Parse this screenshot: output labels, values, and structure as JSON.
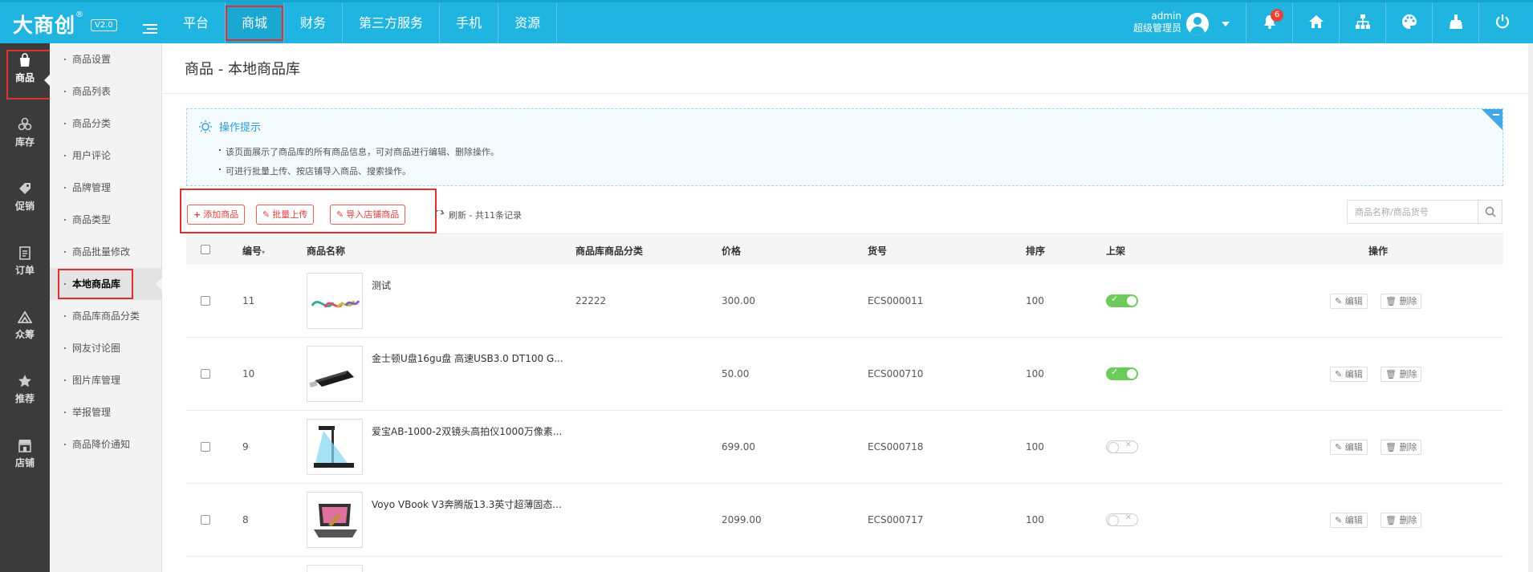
{
  "header": {
    "logo": "大商创",
    "logo_mark": "®",
    "version": "V2.0",
    "nav": [
      "平台",
      "商城",
      "财务",
      "第三方服务",
      "手机",
      "资源"
    ],
    "active_nav": "商城",
    "user_name": "admin",
    "user_role": "超级管理员",
    "notification_count": "6",
    "tools": [
      "bell-icon",
      "home-icon",
      "sitemap-icon",
      "palette-icon",
      "clean-icon",
      "power-icon"
    ]
  },
  "iconbar": [
    {
      "label": "商品",
      "icon": "bag-icon",
      "active": true
    },
    {
      "label": "库存",
      "icon": "stock-icon"
    },
    {
      "label": "促销",
      "icon": "tag-icon"
    },
    {
      "label": "订单",
      "icon": "order-icon"
    },
    {
      "label": "众筹",
      "icon": "crowdfund-icon"
    },
    {
      "label": "推荐",
      "icon": "star-icon"
    },
    {
      "label": "店铺",
      "icon": "store-icon"
    }
  ],
  "subnav": [
    "商品设置",
    "商品列表",
    "商品分类",
    "用户评论",
    "品牌管理",
    "商品类型",
    "商品批量修改",
    "本地商品库",
    "商品库商品分类",
    "网友讨论圈",
    "图片库管理",
    "举报管理",
    "商品降价通知"
  ],
  "active_subnav": "本地商品库",
  "page": {
    "title": "商品 - 本地商品库",
    "tips_title": "操作提示",
    "tips": [
      "该页面展示了商品库的所有商品信息，可对商品进行编辑、删除操作。",
      "可进行批量上传、按店铺导入商品、搜索操作。"
    ],
    "buttons": {
      "add": "添加商品",
      "batch_upload": "批量上传",
      "import": "导入店铺商品"
    },
    "refresh_text": "刷新 - 共11条记录",
    "search_placeholder": "商品名称/商品货号"
  },
  "table": {
    "headers": {
      "id": "编号",
      "name": "商品名称",
      "category": "商品库商品分类",
      "price": "价格",
      "sn": "货号",
      "sort": "排序",
      "on_sale": "上架",
      "actions": "操作"
    },
    "edit_label": "编辑",
    "delete_label": "删除",
    "rows": [
      {
        "id": "11",
        "name": "测试",
        "category": "22222",
        "price": "300.00",
        "sn": "ECS000011",
        "sort": "100",
        "on_sale": true
      },
      {
        "id": "10",
        "name": "金士顿U盘16gu盘 高速USB3.0 DT100 G...",
        "category": "",
        "price": "50.00",
        "sn": "ECS000710",
        "sort": "100",
        "on_sale": true
      },
      {
        "id": "9",
        "name": "爱宝AB-1000-2双镜头高拍仪1000万像素...",
        "category": "",
        "price": "699.00",
        "sn": "ECS000718",
        "sort": "100",
        "on_sale": false
      },
      {
        "id": "8",
        "name": "Voyo VBook V3奔腾版13.3英寸超薄固态...",
        "category": "",
        "price": "2099.00",
        "sn": "ECS000717",
        "sort": "100",
        "on_sale": false
      }
    ]
  },
  "colors": {
    "topbar": "#1fb5e0",
    "iconbar": "#3b3b3b",
    "accent_red": "#e03030",
    "switch_on": "#6ccb5a"
  }
}
